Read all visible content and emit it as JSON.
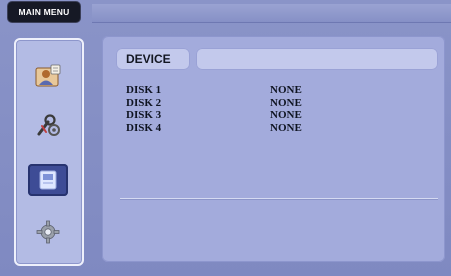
{
  "menu": {
    "title": "MAIN MENU"
  },
  "sidebar": {
    "items": [
      {
        "icon": "user-record-icon",
        "active": false
      },
      {
        "icon": "wrench-tools-icon",
        "active": false
      },
      {
        "icon": "disk-device-icon",
        "active": true
      },
      {
        "icon": "gear-icon",
        "active": false
      }
    ]
  },
  "device": {
    "header_label": "DEVICE",
    "disks": [
      {
        "name": "DISK 1",
        "status": "NONE"
      },
      {
        "name": "DISK 2",
        "status": "NONE"
      },
      {
        "name": "DISK 3",
        "status": "NONE"
      },
      {
        "name": "DISK 4",
        "status": "NONE"
      }
    ]
  }
}
